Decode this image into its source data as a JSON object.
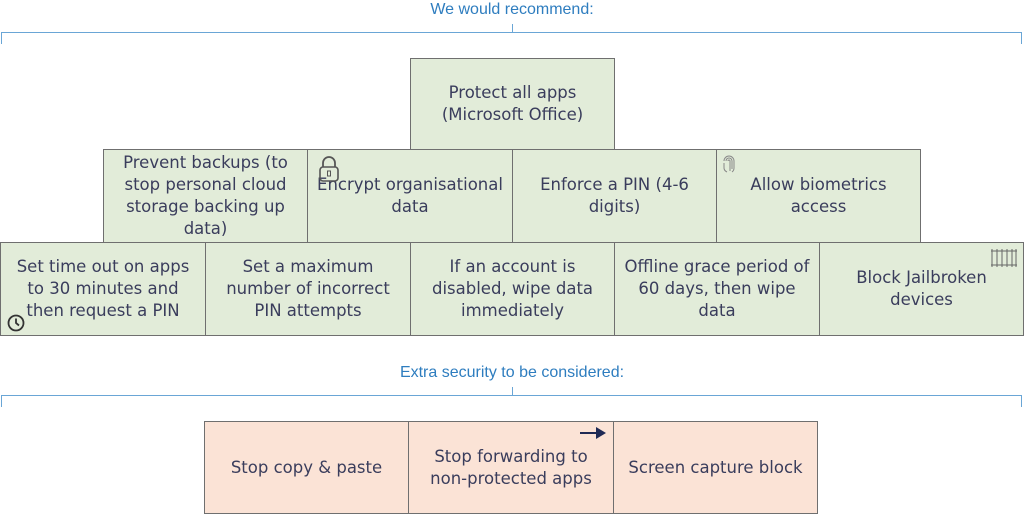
{
  "sections": {
    "recommend": {
      "heading": "We would recommend:",
      "rows": [
        [
          {
            "label": "Protect all apps (Microsoft Office)"
          }
        ],
        [
          {
            "label": "Prevent backups (to stop personal cloud storage backing up data)"
          },
          {
            "label": "Encrypt organisational data",
            "icon": "lock-icon"
          },
          {
            "label": "Enforce a PIN (4-6 digits)"
          },
          {
            "label": "Allow biometrics access",
            "icon": "fingerprint-icon"
          }
        ],
        [
          {
            "label": "Set time out on apps to 30 minutes and then request a PIN",
            "icon": "clock-icon"
          },
          {
            "label": "Set a maximum number of incorrect PIN attempts"
          },
          {
            "label": "If an account is disabled, wipe data immediately"
          },
          {
            "label": "Offline grace period of 60 days, then wipe data"
          },
          {
            "label": "Block Jailbroken devices",
            "icon": "jail-bars-icon"
          }
        ]
      ]
    },
    "extra": {
      "heading": "Extra security to be considered:",
      "items": [
        {
          "label": "Stop copy & paste"
        },
        {
          "label": "Stop forwarding to non-protected apps",
          "icon": "arrow-right-icon"
        },
        {
          "label": "Screen capture block"
        }
      ]
    }
  },
  "colors": {
    "heading": "#2e7dbf",
    "bracket": "#6aa6d6",
    "recommend_fill": "#e2ecd9",
    "extra_fill": "#fbe3d6",
    "text": "#3a3d5c",
    "border": "#6f6f6f"
  }
}
